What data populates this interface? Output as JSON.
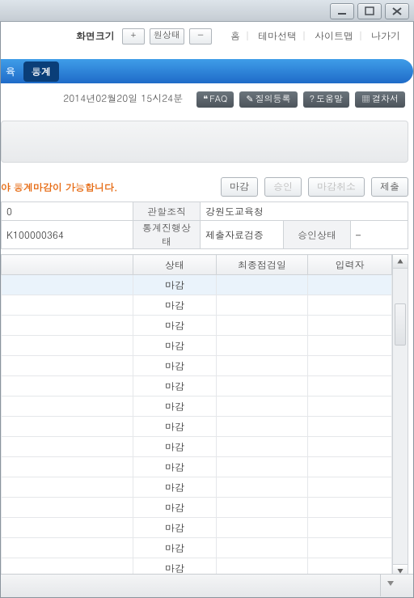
{
  "topbar": {
    "screenSizeLabel": "화면크기",
    "plus": "+",
    "original": "원상태",
    "minus": "−",
    "links": {
      "home": "홈",
      "theme": "테마선택",
      "sitemap": "사이트맵",
      "logout": "나가기"
    }
  },
  "bluenav": {
    "item_left": "육",
    "active": "통계"
  },
  "dateline": {
    "datetime": "2014년02월20일  15시24분",
    "buttons": {
      "faq": "FAQ",
      "qna": "질의등록",
      "help": "도움말",
      "approval": "결차서"
    }
  },
  "message": "야 통계마감이 가능합니다.",
  "actions": {
    "close": "마감",
    "approve": "승인",
    "cancel": "마감취소",
    "submit": "제출"
  },
  "info": {
    "row1": {
      "v1": "0",
      "h2": "관할조직",
      "v2": "강원도교육청"
    },
    "row2": {
      "v1": "K100000364",
      "h2": "통계진행상태",
      "v2": "제출자료검증",
      "h3": "승인상태",
      "v3": "–"
    }
  },
  "grid": {
    "headers": {
      "c1": "",
      "c2": "상태",
      "c3": "최종점검일",
      "c4": "입력자"
    },
    "statusValue": "마감",
    "rowCount": 15
  }
}
